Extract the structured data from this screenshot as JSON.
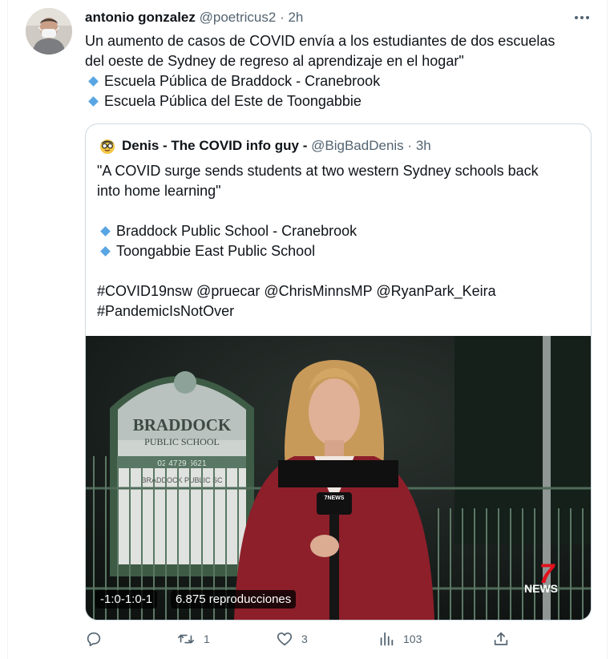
{
  "tweet": {
    "author_name": "antonio gonzalez",
    "handle": "@poetricus2",
    "separator": "·",
    "time": "2h",
    "text_lines": [
      "Un aumento de casos de COVID envía a los estudiantes de dos escuelas",
      "del oeste de Sydney de regreso al aprendizaje en el hogar\""
    ],
    "bullets": [
      "Escuela Pública de Braddock - Cranebrook",
      "Escuela Pública del Este de Toongabbie"
    ]
  },
  "quote": {
    "author_name": "Denis - The COVID info guy -",
    "handle": "@BigBadDenis",
    "separator": "·",
    "time": "3h",
    "text_lines": [
      "\"A COVID surge sends students at two western Sydney schools back",
      "into home learning\""
    ],
    "bullets": [
      "Braddock Public School - Cranebrook",
      "Toongabbie East Public School"
    ],
    "hashtag_lines": [
      "#COVID19nsw @pruecar @ChrisMinnsMP @RyanPark_Keira",
      "#PandemicIsNotOver"
    ],
    "media": {
      "timestamp": "-1:0-1:0-1",
      "views": "6.875 reproducciones",
      "sign_title": "BRADDOCK",
      "sign_subtitle": "PUBLIC SCHOOL",
      "sign_phone": "02 4729 6621",
      "sign_notice": "BRADDOCK PUBLIC SC",
      "mic_label": "7NEWS",
      "channel_logo": "7",
      "channel_name": "NEWS"
    }
  },
  "actions": {
    "reply_count": "",
    "retweet_count": "1",
    "like_count": "3",
    "views_count": "103"
  },
  "colors": {
    "text": "#0f1419",
    "muted": "#536471",
    "diamond": "#5aa6e4",
    "border": "#cfd9de"
  }
}
